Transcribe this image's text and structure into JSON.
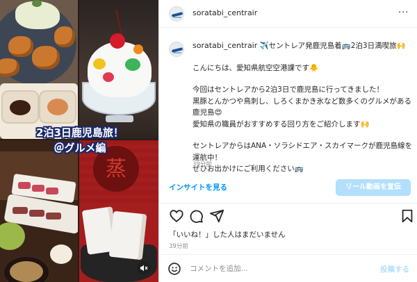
{
  "colors": {
    "accent": "#0095f6",
    "accent_disabled": "#b2dffc",
    "text": "#262626",
    "muted": "#8e8e8e"
  },
  "media": {
    "overlay_line1": "2泊3日鹿児島旅！",
    "overlay_line2": "＠グルメ編",
    "mute_icon": "speaker-muted-icon",
    "kanji": "蒸"
  },
  "header": {
    "username": "soratabi_centrair",
    "more_icon": "more-horizontal-icon",
    "more_label": "···"
  },
  "caption": {
    "username": "soratabi_centrair",
    "title": "✈️セントレア発鹿児島着🚌2泊3日満喫旅🙌",
    "greeting": "こんにちは、愛知県航空空港課です🐥",
    "body1": "今回はセントレアから2泊3日で鹿児島に行ってきました！",
    "body2": "黒豚とんかつや鳥刺し、しろくまかき氷など数多くのグルメがある鹿児島😍",
    "body3": "愛知県の職員がおすすめする回り方をご紹介します🙌",
    "body4": "セントレアからはANA・ソラシドエア・スカイマークが鹿児島線を運航中！",
    "body5": "ぜひお出かけにご利用ください🚌",
    "time_ago": "39分前"
  },
  "insights_link": "インサイトを見る",
  "promote_button": "リール動画を宣伝",
  "likes_text": "「いいね！」した人はまだいません",
  "post_time": "39分前",
  "comment": {
    "placeholder": "コメントを追加...",
    "post_label": "投稿する"
  },
  "icons": {
    "like": "heart-icon",
    "comment": "comment-icon",
    "share": "share-icon",
    "save": "bookmark-icon",
    "emoji": "emoji-icon"
  }
}
